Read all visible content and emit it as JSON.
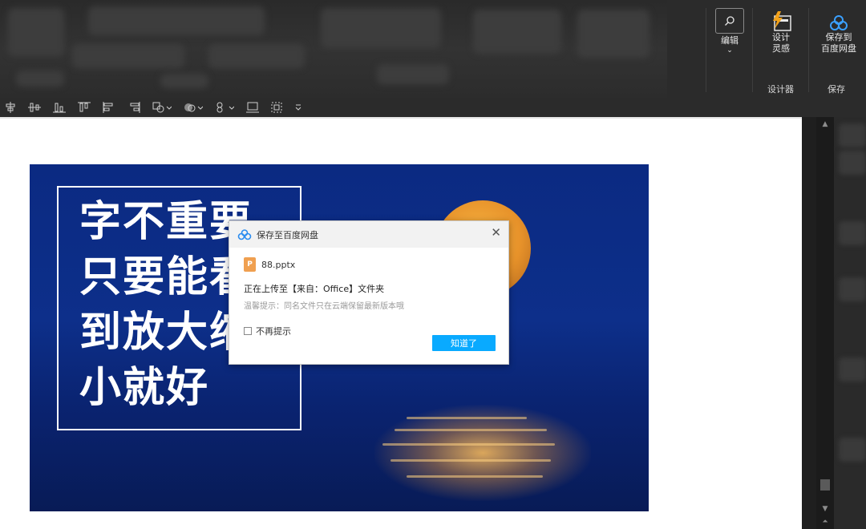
{
  "ribbon": {
    "edit": {
      "label": "编辑",
      "icon": "search-icon"
    },
    "design_ideas": {
      "label_line1": "设计",
      "label_line2": "灵感",
      "icon": "design-ideas-icon"
    },
    "baidu_save": {
      "label_line1": "保存到",
      "label_line2": "百度网盘",
      "icon": "baidu-netdisk-icon"
    },
    "groups": {
      "designer": "设计器",
      "save": "保存"
    }
  },
  "toolbar": {
    "icons": [
      "align-center-icon",
      "distribute-icon",
      "align-bottom-icon",
      "align-top-icon",
      "align-left-icon",
      "align-right-icon",
      "shape-fill-icon",
      "shape-outline-icon",
      "shape-effects-icon",
      "picture-icon",
      "selection-icon",
      "more-icon"
    ]
  },
  "slide": {
    "lines": [
      "字不重要",
      "只要能看",
      "到放大缩",
      "小就好"
    ],
    "background_color": "#0d2f8a",
    "moon_color": "#e7922a"
  },
  "dialog": {
    "title": "保存至百度网盘",
    "close_glyph": "✕",
    "file_icon_letter": "P",
    "file_name": "88.pptx",
    "status": "正在上传至【来自：Office】文件夹",
    "tip": "温馨提示：同名文件只在云端保留最新版本哦",
    "checkbox_label": "不再提示",
    "ok_label": "知道了",
    "accent_color": "#09aaff"
  }
}
